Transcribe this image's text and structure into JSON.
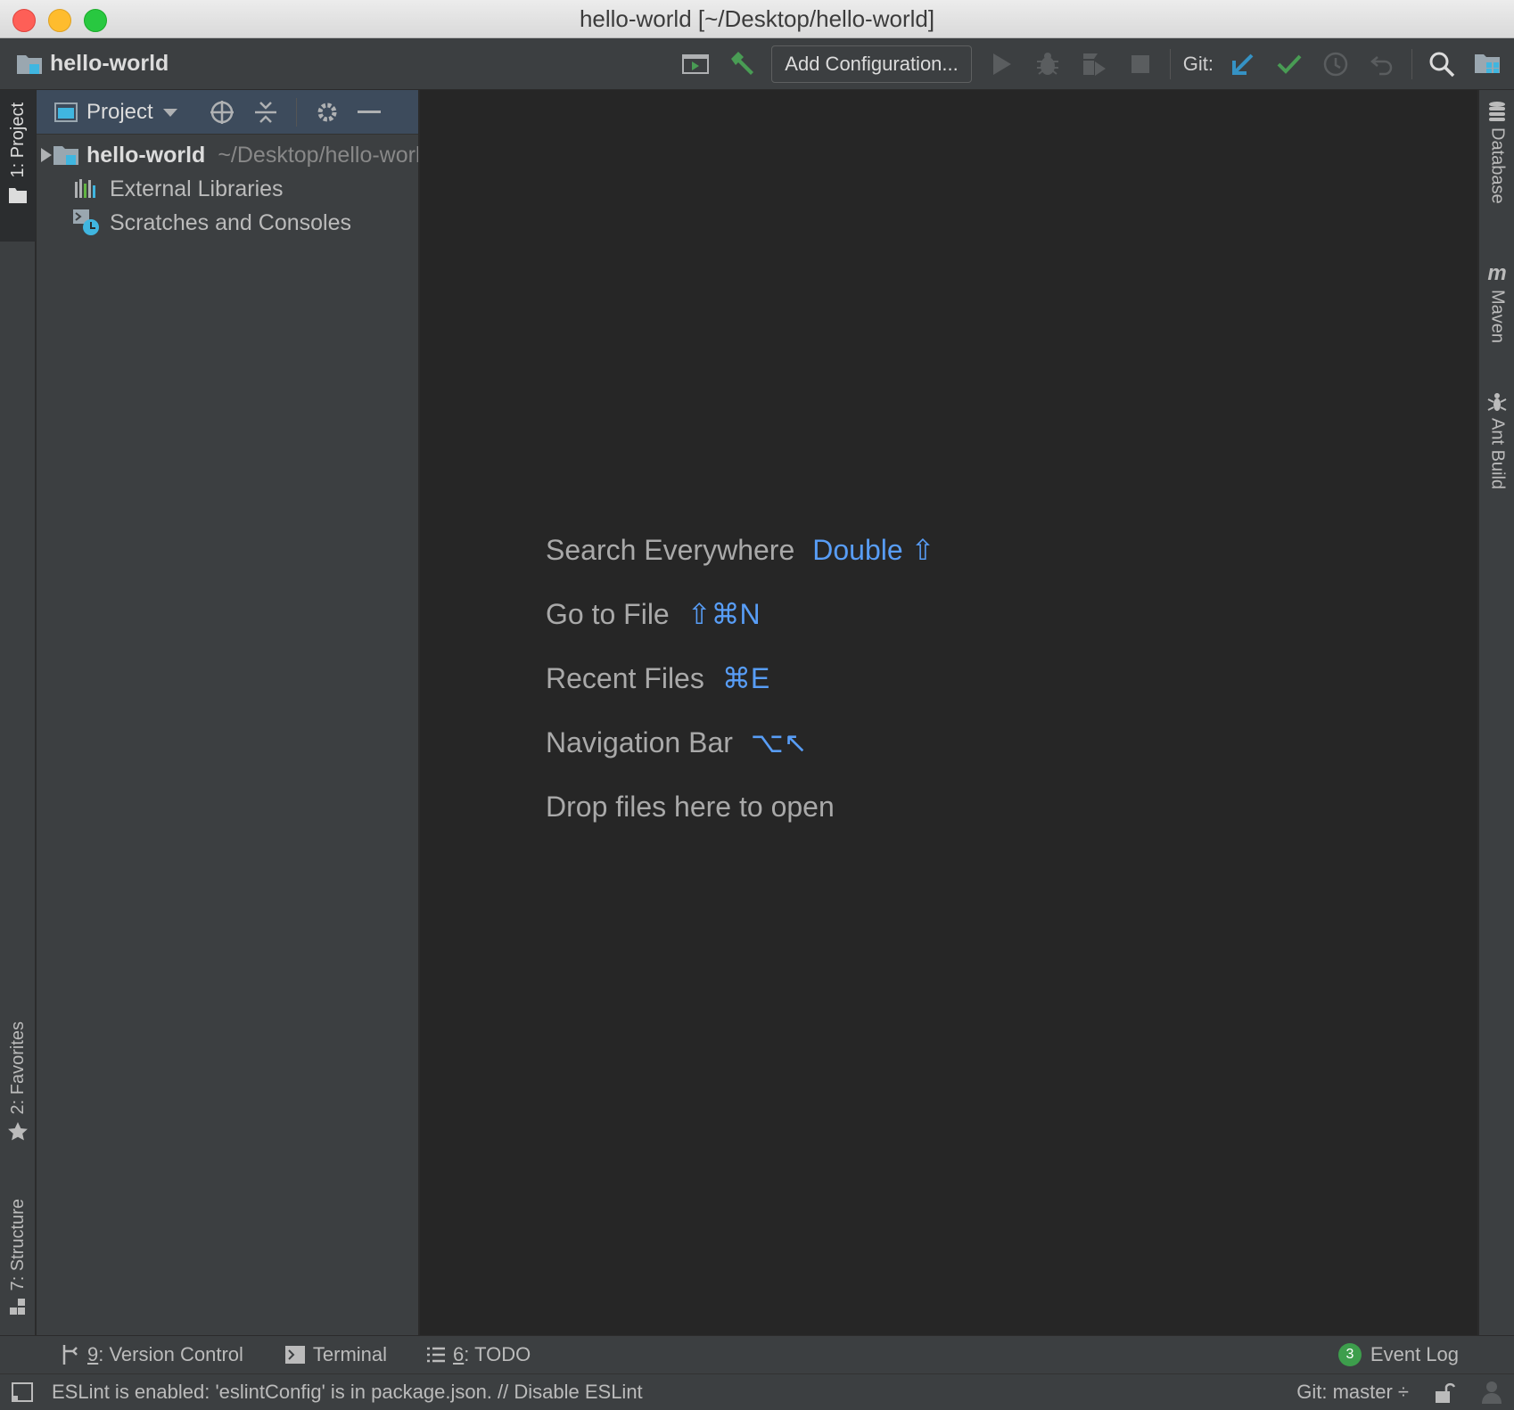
{
  "window": {
    "title": "hello-world [~/Desktop/hello-world]"
  },
  "toolbar": {
    "project_name": "hello-world",
    "add_configuration": "Add Configuration...",
    "git_label": "Git:"
  },
  "left_stripe": {
    "project_tab": "1: Project",
    "favorites_tab": "2: Favorites",
    "structure_tab": "7: Structure"
  },
  "right_stripe": {
    "database_tab": "Database",
    "maven_tab": "Maven",
    "ant_tab": "Ant Build"
  },
  "project_panel": {
    "view_label": "Project",
    "tree": [
      {
        "label": "hello-world",
        "path": "~/Desktop/hello-world"
      },
      {
        "label": "External Libraries"
      },
      {
        "label": "Scratches and Consoles"
      }
    ]
  },
  "editor": {
    "hints": [
      {
        "label": "Search Everywhere",
        "shortcut": "Double ⇧"
      },
      {
        "label": "Go to File",
        "shortcut": "⇧⌘N"
      },
      {
        "label": "Recent Files",
        "shortcut": "⌘E"
      },
      {
        "label": "Navigation Bar",
        "shortcut": "⌥↖"
      },
      {
        "label": "Drop files here to open",
        "shortcut": ""
      }
    ]
  },
  "bottom_tools": {
    "version_control_num": "9",
    "version_control": ": Version Control",
    "terminal": "Terminal",
    "todo_num": "6",
    "todo": ": TODO",
    "event_log_count": "3",
    "event_log": "Event Log"
  },
  "status": {
    "message": "ESLint is enabled: 'eslintConfig' is in package.json. // Disable ESLint",
    "git_branch": "Git: master ÷"
  },
  "colors": {
    "accent": "#589df6",
    "git_update": "#3592c4",
    "git_commit": "#499c54",
    "run_green": "#499c54"
  }
}
